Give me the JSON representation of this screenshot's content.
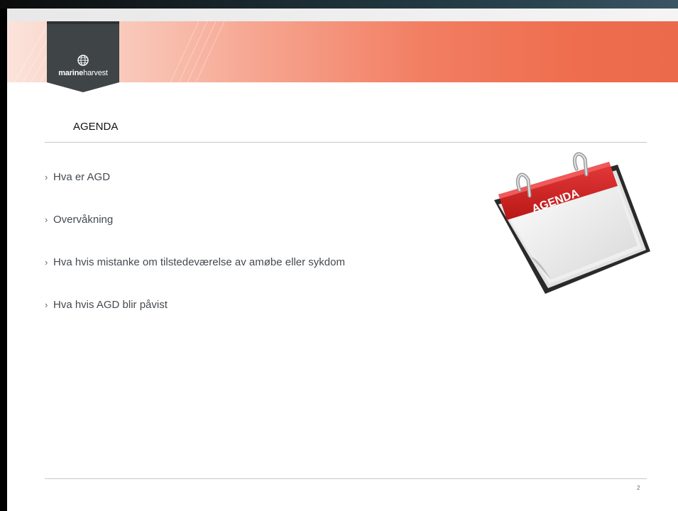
{
  "logo": {
    "brand_bold": "marine",
    "brand_light": "harvest"
  },
  "slide": {
    "title": "AGENDA",
    "bullets": [
      "Hva er AGD",
      "Overvåkning",
      "Hva hvis mistanke om tilstedeværelse av amøbe eller sykdom",
      "Hva hvis AGD blir påvist"
    ],
    "bullet_marker": "›",
    "page_number": "2"
  },
  "calendar_image": {
    "label": "AGENDA"
  },
  "colors": {
    "banner_accent": "#ec6a4c",
    "logo_tab": "#3f4447",
    "calendar_red": "#d42323"
  }
}
